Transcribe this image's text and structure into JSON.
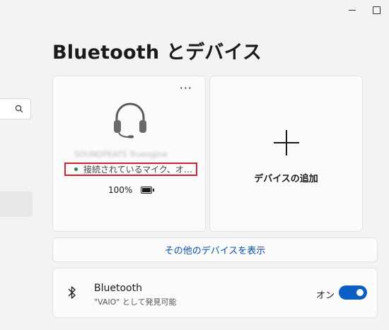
{
  "page": {
    "title": "Bluetooth とデバイス"
  },
  "device": {
    "name": "SOUNDPEATS Truengine",
    "status": "接続されているマイク、オ…",
    "battery": "100%",
    "more_label": "···"
  },
  "add_device": {
    "label": "デバイスの追加"
  },
  "show_more": {
    "label": "その他のデバイスを表示"
  },
  "bluetooth": {
    "title": "Bluetooth",
    "subtitle": "\"VAIO\" として発見可能",
    "toggle_label": "オン",
    "toggle_on": true
  },
  "colors": {
    "accent": "#0a5ec4",
    "status_green": "#1f8a3a",
    "highlight_red": "#d2202f",
    "link_blue": "#0a4fa8"
  },
  "icons": [
    "search-icon",
    "headset-icon",
    "battery-icon",
    "plus-icon",
    "bluetooth-icon",
    "minimize-icon",
    "maximize-icon"
  ]
}
